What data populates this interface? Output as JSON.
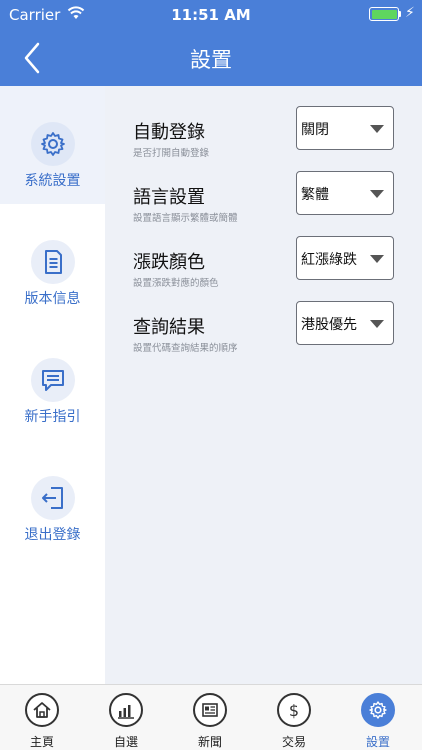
{
  "status_bar": {
    "carrier": "Carrier",
    "time": "11:51 AM"
  },
  "header": {
    "title": "設置"
  },
  "sidebar": {
    "items": [
      {
        "label": "系統設置",
        "icon": "gear-icon",
        "active": true
      },
      {
        "label": "版本信息",
        "icon": "document-icon",
        "active": false
      },
      {
        "label": "新手指引",
        "icon": "chat-icon",
        "active": false
      },
      {
        "label": "退出登錄",
        "icon": "logout-icon",
        "active": false
      }
    ]
  },
  "settings": [
    {
      "title": "自動登錄",
      "description": "是否打開自動登錄",
      "value": "關閉"
    },
    {
      "title": "語言設置",
      "description": "設置語言顯示繁體或簡體",
      "value": "繁體"
    },
    {
      "title": "漲跌顏色",
      "description": "設置漲跌對應的顏色",
      "value": "紅漲綠跌"
    },
    {
      "title": "查詢結果",
      "description": "設置代碼查詢結果的順序",
      "value": "港股優先"
    }
  ],
  "tabbar": {
    "tabs": [
      {
        "label": "主頁",
        "icon": "home-icon",
        "active": false
      },
      {
        "label": "自選",
        "icon": "chart-icon",
        "active": false
      },
      {
        "label": "新聞",
        "icon": "news-icon",
        "active": false
      },
      {
        "label": "交易",
        "icon": "dollar-icon",
        "active": false
      },
      {
        "label": "設置",
        "icon": "gear-icon",
        "active": true
      }
    ]
  },
  "colors": {
    "accent": "#4a7fd8",
    "sidebar_text": "#3a6fc9",
    "content_bg": "#eef1f7"
  }
}
